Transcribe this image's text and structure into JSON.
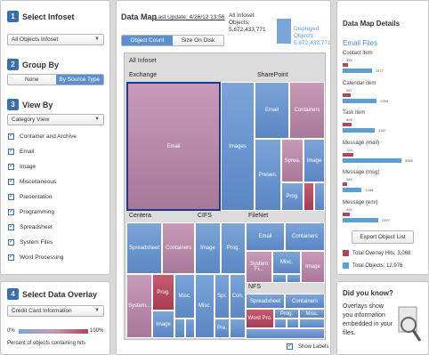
{
  "left": {
    "s1": {
      "num": "1",
      "title": "Select Infoset",
      "dropdown": "All Objects Infoset"
    },
    "s2": {
      "num": "2",
      "title": "Group By",
      "options": [
        "None",
        "By Source Type"
      ]
    },
    "s3": {
      "num": "3",
      "title": "View By",
      "dropdown": "Category View",
      "items": [
        "Container and Archive",
        "Email",
        "Image",
        "Miscellaneous",
        "Presentation",
        "Programming",
        "Spreadsheet",
        "System Files",
        "Word Processing"
      ]
    },
    "s4": {
      "num": "4",
      "title": "Select Data Overlay",
      "dropdown": "Credit Card Information",
      "scale_min": "0%",
      "scale_max": "100%",
      "caption": "Percent of objects containing hits"
    }
  },
  "main": {
    "title": "Data Map",
    "last_update": "Last Update: 4/26/12 13:56",
    "infoset_label": "All Infoset\nObjects:\n5,672,433,771",
    "displayed_label": "Displayed\nObjects:\n5,672,433,771",
    "tabs": [
      "Object Count",
      "Size On Disk"
    ],
    "root": "All Infoset",
    "groups": {
      "exchange": "Exchange",
      "sharepoint": "SharePoint",
      "centera": "Centera",
      "cifs": "CIFS",
      "filenet": "FileNet",
      "nfs": "NFS"
    },
    "tiles": {
      "ex_email": "Email",
      "ex_images": "Images",
      "sp_email": "Email",
      "sp_containers": "Containers",
      "sp_presen": "Presen.",
      "sp_sprea": "Sprea.",
      "sp_image": "Image",
      "sp_prog": "Prog.",
      "ce_spreadsheet": "Spreadsheet",
      "ce_containers": "Containers",
      "ce_system": "System...",
      "ce_prog": "Prog.",
      "ce_misc": "Misc.",
      "ce_image": "Image",
      "ci_image": "Image",
      "ci_prog": "Prog.",
      "ci_misc": "Misc.",
      "ci_spr": "Spr.",
      "ci_con": "Con.",
      "ci_pre": "Pre.",
      "fn_email": "Email",
      "fn_containers": "Containers",
      "fn_system": "System Fi...",
      "fn_misc": "Misc.",
      "fn_image": "Image",
      "nfs_spreadsheet": "Spreadsheet",
      "nfs_containers": "Containers",
      "nfs_word": "Word Pro.",
      "nfs_prog": "Prog.",
      "nfs_misc": "Misc."
    },
    "show_labels": "Show Labels"
  },
  "details": {
    "title": "Data Map Details",
    "subtitle": "Email Files",
    "items": [
      {
        "label": "Contact item",
        "red": "355",
        "blue": "1977"
      },
      {
        "label": "Calendar item",
        "red": "557",
        "blue": "2305"
      },
      {
        "label": "Task item",
        "red": "608",
        "blue": "2167"
      },
      {
        "label": "Message (mail)",
        "red": "724",
        "blue": "3965"
      },
      {
        "label": "Message (msg)",
        "red": "289",
        "blue": "1285"
      },
      {
        "label": "Message (eml)",
        "red": "455",
        "blue": "2397"
      }
    ],
    "export_button": "Export Object List",
    "legend_red": "Total Overlay Hits: 3,068",
    "legend_blue": "Total Objects: 12,976",
    "colors": {
      "red": "#b44457",
      "blue": "#5a9fd8"
    }
  },
  "know": {
    "title": "Did you know?",
    "text": "Overlays show you information embedded in your files.",
    "icon": "magnifier-document-icon"
  }
}
